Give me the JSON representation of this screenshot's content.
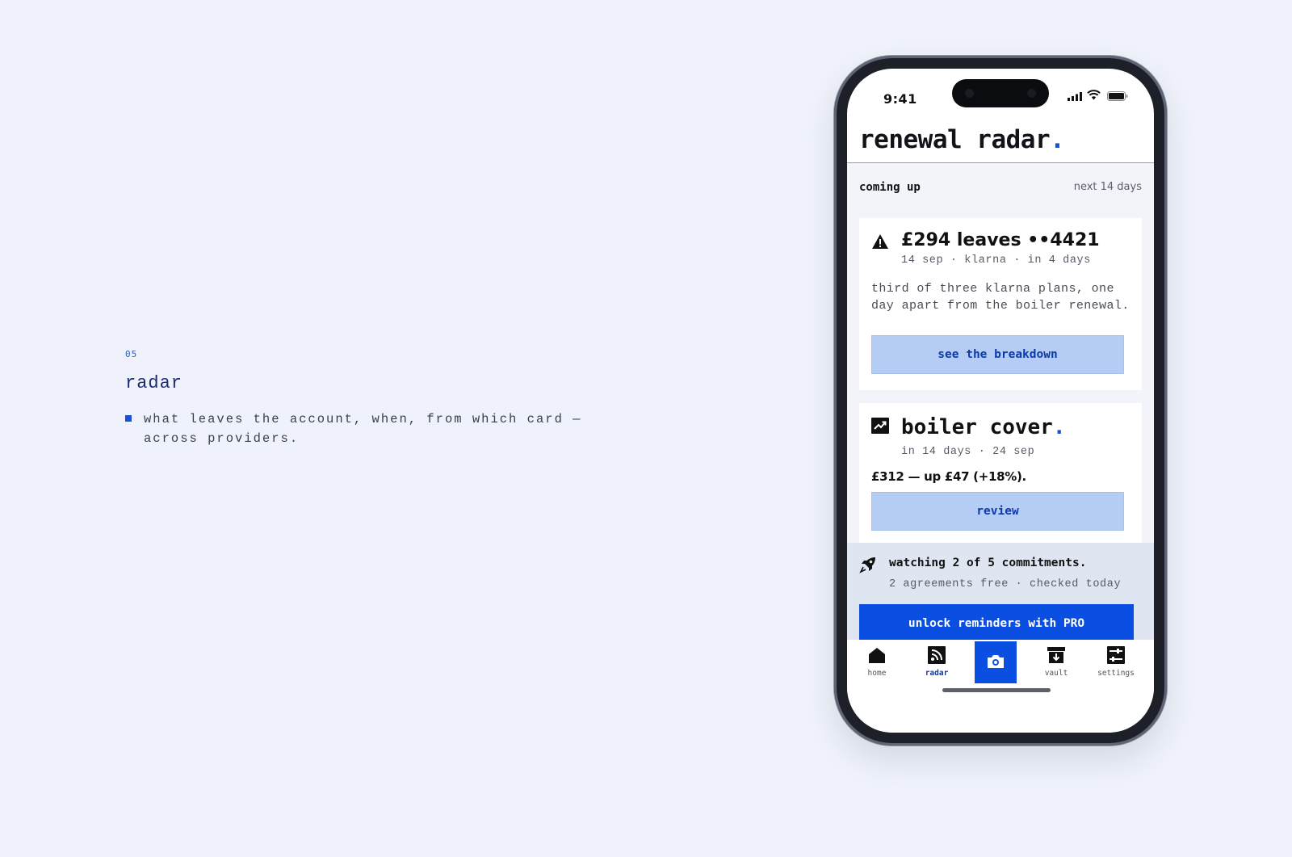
{
  "intro": {
    "number": "05",
    "title": "radar",
    "description": "what leaves the account, when, from which card — across providers."
  },
  "status_bar": {
    "time": "9:41",
    "icons": [
      "signal-icon",
      "wifi-icon",
      "battery-icon"
    ]
  },
  "app": {
    "title": "renewal radar",
    "title_dot": "."
  },
  "section": {
    "label": "coming up",
    "range": "next 14 days"
  },
  "cards": [
    {
      "icon": "warning-icon",
      "headline": "£294 leaves ••4421",
      "meta": "14 sep · klarna · in 4 days",
      "body": "third of three klarna plans, one day apart from the boiler renewal.",
      "button": "see the breakdown"
    },
    {
      "icon": "trending-up-icon",
      "headline": "boiler cover",
      "headline_dot": ".",
      "meta": "in 14 days · 24 sep",
      "price": "£312 — up £47 (+18%).",
      "button": "review"
    }
  ],
  "watch": {
    "icon": "rocket-icon",
    "headline": "watching 2 of 5 commitments.",
    "meta": "2 agreements free · checked today",
    "button": "unlock reminders with PRO"
  },
  "tabs": [
    {
      "label": "home",
      "icon": "home-icon"
    },
    {
      "label": "radar",
      "icon": "rss-icon",
      "active": true
    },
    {
      "label": "",
      "icon": "camera-icon"
    },
    {
      "label": "vault",
      "icon": "archive-download-icon"
    },
    {
      "label": "settings",
      "icon": "sliders-icon"
    }
  ],
  "colors": {
    "accent": "#0b4fe2",
    "accent_light": "#b5cdf4",
    "accent_text": "#0d3aa8",
    "page_bg": "#eff2fa"
  }
}
